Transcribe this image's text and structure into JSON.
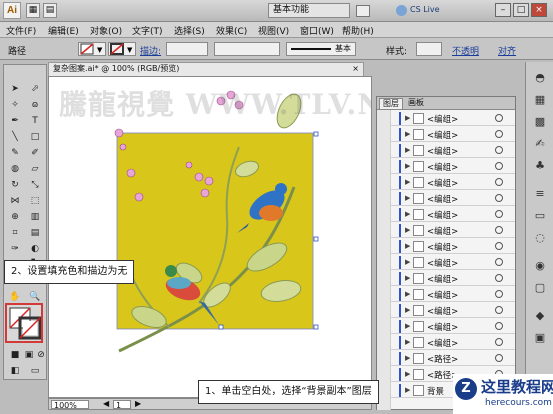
{
  "app": {
    "logo": "Ai",
    "workspace": "基本功能",
    "cs_live": "CS Live"
  },
  "menu": [
    "文件(F)",
    "编辑(E)",
    "对象(O)",
    "文字(T)",
    "选择(S)",
    "效果(C)",
    "视图(V)",
    "窗口(W)",
    "帮助(H)"
  ],
  "control_bar": {
    "selection": "路径",
    "stroke_label": "描边:",
    "style_label": "样式:",
    "brush": "基本",
    "align_label": "对齐",
    "transform_label": "不透明"
  },
  "document": {
    "tab_title": "复杂图案.ai* @ 100% (RGB/预览)",
    "zoom": "100%",
    "page": "1",
    "watermark": "騰龍視覺 WWW.TLV.NET"
  },
  "layers_panel": {
    "tabs": [
      "图层",
      "画板"
    ],
    "rows": [
      "<编组>",
      "<编组>",
      "<编组>",
      "<编组>",
      "<编组>",
      "<编组>",
      "<编组>",
      "<编组>",
      "<编组>",
      "<编组>",
      "<编组>",
      "<编组>",
      "<编组>",
      "<编组>",
      "<编组>",
      "<路径>",
      "<路径>",
      "背景"
    ]
  },
  "callouts": {
    "step2": "2、设置填充色和描边为无",
    "step1": "1、单击空白处，选择“背景副本”图层"
  },
  "site": {
    "name": "这里教程网",
    "url": "herecours.com"
  },
  "colors": {
    "artboard": "#d8c61a",
    "accent_blue": "#3355cc",
    "callout_border": "#d23a3a"
  }
}
